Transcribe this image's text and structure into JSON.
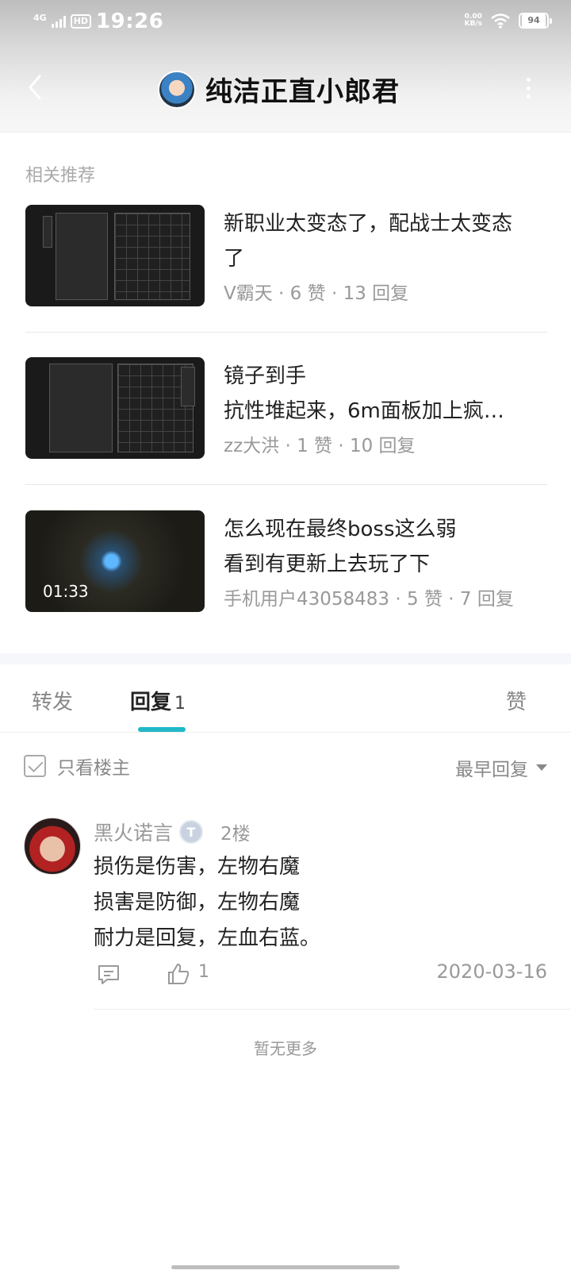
{
  "status_bar": {
    "network": "4G",
    "hd": "HD",
    "time": "19:26",
    "speed_value": "0.00",
    "speed_unit": "KB/s",
    "battery": "94"
  },
  "nav": {
    "title": "纯洁正直小郎君"
  },
  "related": {
    "label": "相关推荐",
    "items": [
      {
        "title_line1": "新职业太变态了，配战士太变态",
        "title_line2": "了",
        "author": "V霸天",
        "likes": "6 赞",
        "replies": "13 回复",
        "duration": ""
      },
      {
        "title_line1": "镜子到手",
        "title_line2": "抗性堆起来，6m面板加上疯…",
        "author": "zz大洪",
        "likes": "1 赞",
        "replies": "10 回复",
        "duration": ""
      },
      {
        "title_line1": "怎么现在最终boss这么弱",
        "title_line2": "看到有更新上去玩了下",
        "author": "手机用户43058483",
        "likes": "5 赞",
        "replies": "7 回复",
        "duration": "01:33"
      }
    ],
    "dot": "·"
  },
  "tabs": {
    "forward": "转发",
    "reply": "回复",
    "reply_count": "1",
    "like": "赞"
  },
  "filter": {
    "only_op": "只看楼主",
    "sort": "最早回复"
  },
  "comment": {
    "user": "黑火诺言",
    "level": "T",
    "floor": "2楼",
    "lines": [
      "损伤是伤害，左物右魔",
      "损害是防御，左物右魔",
      "耐力是回复，左血右蓝。"
    ],
    "like_count": "1",
    "date": "2020-03-16"
  },
  "footer": {
    "no_more": "暂无更多"
  },
  "colors": {
    "accent": "#21b8c8",
    "meta_text": "#999999"
  },
  "icons": {
    "back": "chevron-left-icon",
    "more": "more-vertical-icon",
    "comment": "comment-icon",
    "like": "thumbs-up-icon",
    "sort": "caret-down-icon",
    "checkbox": "checkbox-icon"
  }
}
